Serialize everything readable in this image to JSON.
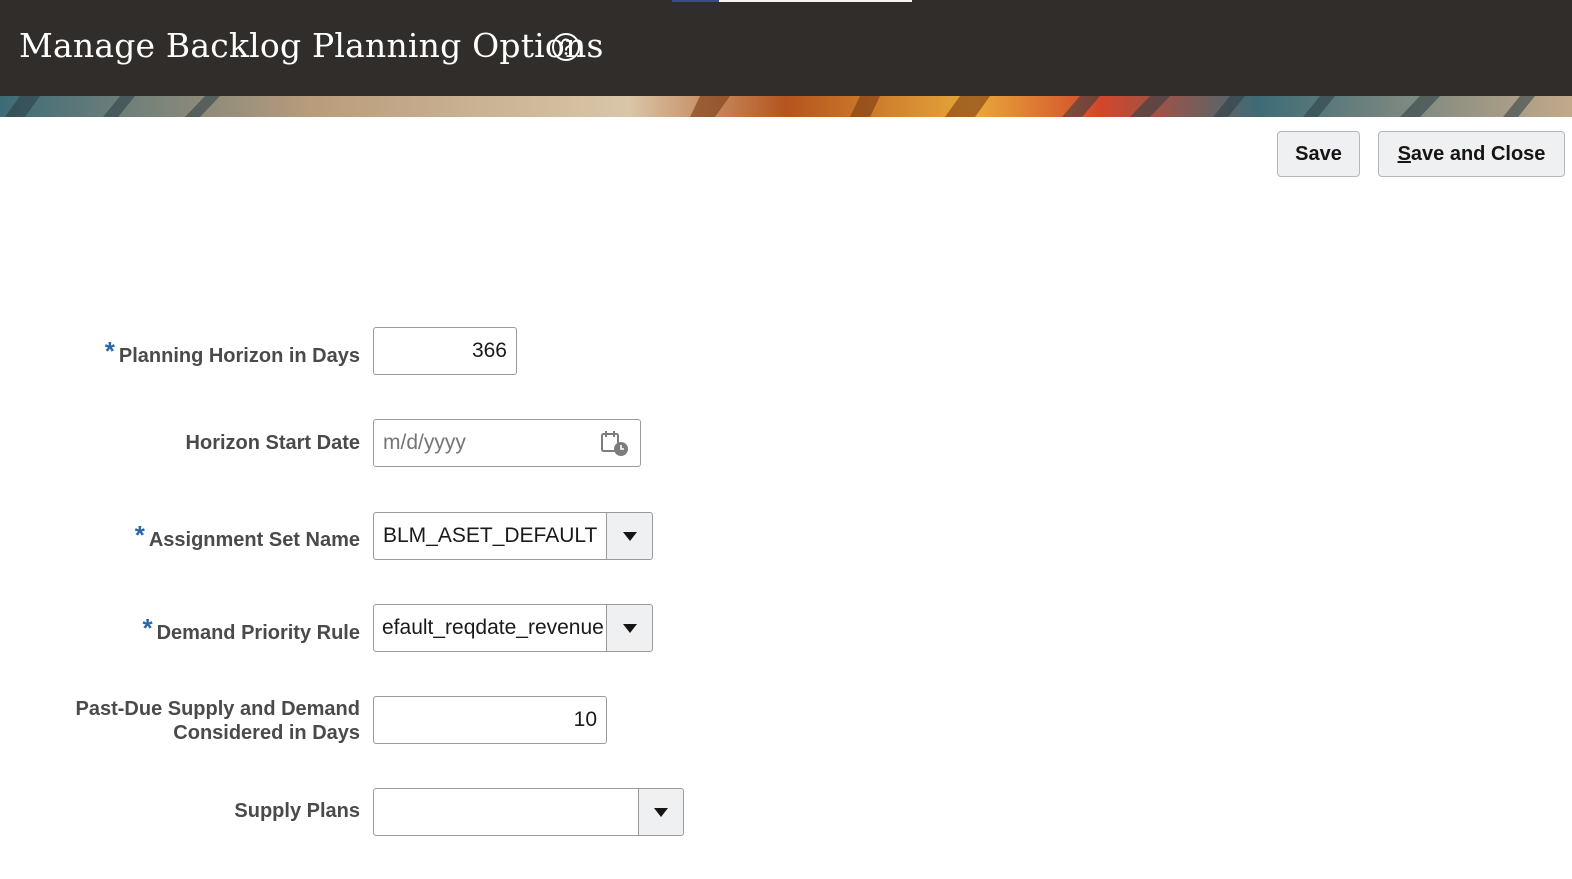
{
  "header": {
    "title": "Manage Backlog Planning Options",
    "help_icon": "help-circle-icon"
  },
  "toolbar": {
    "save_label": "Save",
    "save_close_mnemonic": "S",
    "save_close_rest": "ave and Close"
  },
  "form": {
    "planning_horizon": {
      "label": "Planning Horizon in Days",
      "required": "*",
      "value": "366"
    },
    "horizon_start_date": {
      "label": "Horizon Start Date",
      "value": "",
      "placeholder": "m/d/yyyy",
      "icon": "calendar-icon"
    },
    "assignment_set": {
      "label": "Assignment Set Name",
      "required": "*",
      "value": "BLM_ASET_DEFAULT",
      "icon": "chevron-down-icon"
    },
    "demand_priority_rule": {
      "label": "Demand Priority Rule",
      "required": "*",
      "value": "efault_reqdate_revenue",
      "icon": "chevron-down-icon"
    },
    "past_due_days": {
      "label_line1": "Past-Due Supply and Demand",
      "label_line2": "Considered in Days",
      "value": "10"
    },
    "supply_plans": {
      "label": "Supply Plans",
      "value": "",
      "icon": "chevron-down-icon"
    }
  },
  "colors": {
    "header_bg": "#312d2a",
    "required_marker": "#2a67a6",
    "button_bg": "#eef0f1"
  }
}
